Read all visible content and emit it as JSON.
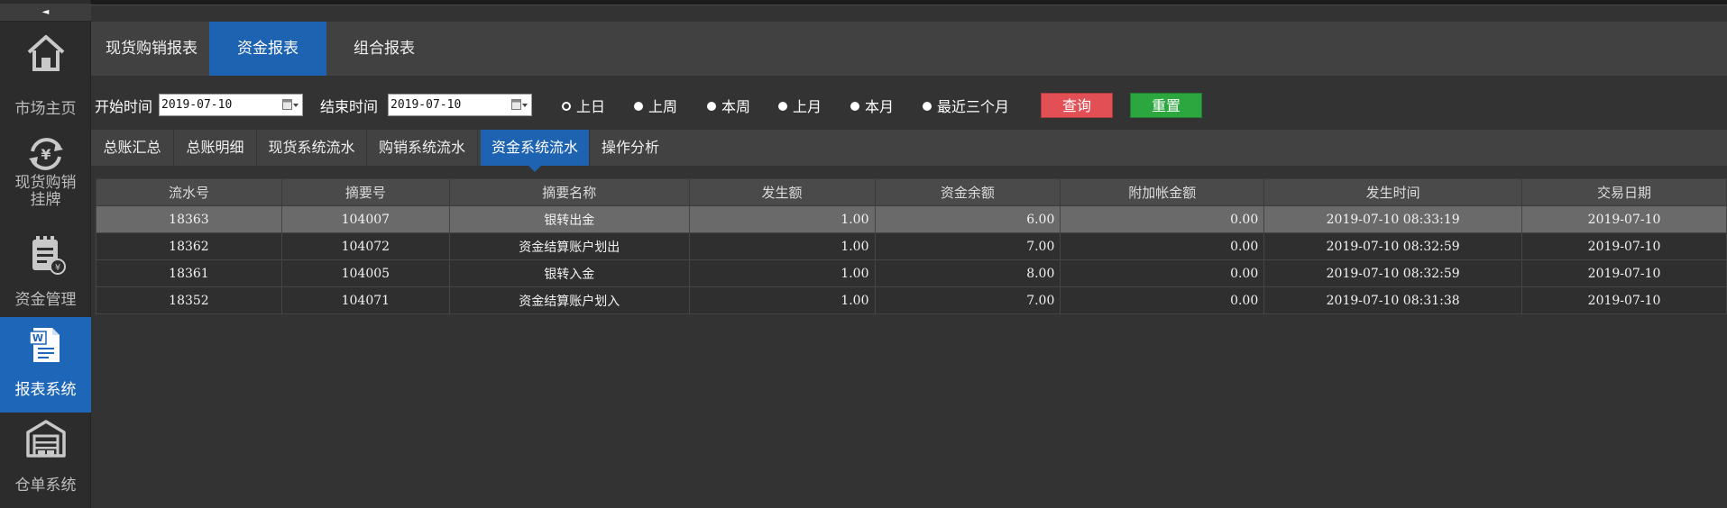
{
  "sidebar": {
    "collapse": "◄",
    "items": [
      {
        "label": "市场主页",
        "icon": "home-icon"
      },
      {
        "label": "现货购销挂牌",
        "line1": "现货购销",
        "line2": "挂牌",
        "icon": "yuan-exchange-icon"
      },
      {
        "label": "资金管理",
        "icon": "clipboard-money-icon"
      },
      {
        "label": "报表系统",
        "icon": "word-document-icon"
      },
      {
        "label": "仓单系统",
        "icon": "warehouse-icon"
      }
    ]
  },
  "report_tabs": [
    "现货购销报表",
    "资金报表",
    "组合报表"
  ],
  "filter": {
    "start_label": "开始时间",
    "start_value": "2019-07-10",
    "end_label": "结束时间",
    "end_value": "2019-07-10",
    "ranges": [
      "上日",
      "上周",
      "本周",
      "上月",
      "本月",
      "最近三个月"
    ],
    "selected_range": "上日",
    "query_label": "查询",
    "reset_label": "重置"
  },
  "sub_tabs": [
    "总账汇总",
    "总账明细",
    "现货系统流水",
    "购销系统流水",
    "资金系统流水",
    "操作分析"
  ],
  "table": {
    "columns": [
      "流水号",
      "摘要号",
      "摘要名称",
      "发生额",
      "资金余额",
      "附加帐金额",
      "发生时间",
      "交易日期"
    ],
    "rows": [
      [
        "18363",
        "104007",
        "银转出金",
        "1.00",
        "6.00",
        "0.00",
        "2019-07-10 08:33:19",
        "2019-07-10"
      ],
      [
        "18362",
        "104072",
        "资金结算账户划出",
        "1.00",
        "7.00",
        "0.00",
        "2019-07-10 08:32:59",
        "2019-07-10"
      ],
      [
        "18361",
        "104005",
        "银转入金",
        "1.00",
        "8.00",
        "0.00",
        "2019-07-10 08:32:59",
        "2019-07-10"
      ],
      [
        "18352",
        "104071",
        "资金结算账户划入",
        "1.00",
        "7.00",
        "0.00",
        "2019-07-10 08:31:38",
        "2019-07-10"
      ]
    ]
  },
  "colors": {
    "accent": "#1e63b2",
    "query": "#e24f55",
    "reset": "#2ca740",
    "selected_row": "#6a6a6a"
  }
}
